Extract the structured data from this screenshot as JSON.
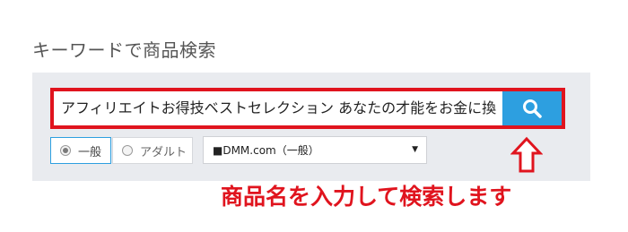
{
  "heading": "キーワードで商品検索",
  "search": {
    "value": "アフィリエイトお得技ベストセレクション あなたの才能をお金に換",
    "button_icon": "search-icon"
  },
  "filters": {
    "options": [
      {
        "label": "一般",
        "selected": true
      },
      {
        "label": "アダルト",
        "selected": false
      }
    ]
  },
  "category_select": {
    "value": "■DMM.com（一般）"
  },
  "annotation": {
    "arrow_icon": "up-arrow-icon",
    "caption": "商品名を入力して検索します",
    "color": "#e0141e"
  },
  "colors": {
    "accent": "#2d9fe0",
    "panel": "#e9ebef"
  }
}
